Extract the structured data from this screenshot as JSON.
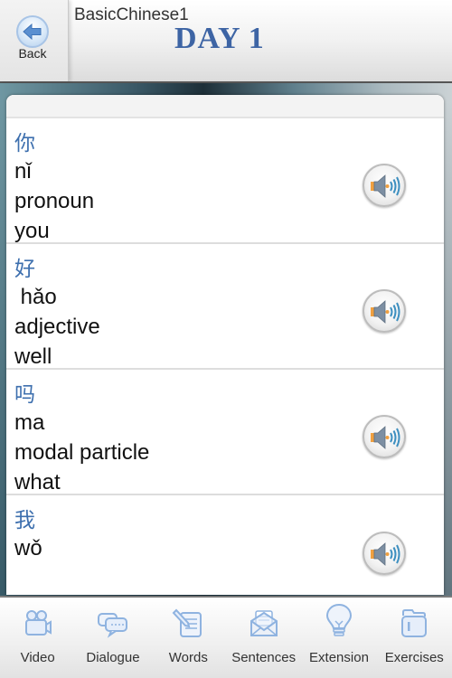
{
  "header": {
    "back_label": "Back",
    "app_title": "BasicChinese1",
    "day_title": "DAY 1"
  },
  "words": [
    {
      "hanzi": "你",
      "pinyin": "nǐ",
      "part_of_speech": "pronoun",
      "meaning": "you",
      "audio_icon": "speaker-icon"
    },
    {
      "hanzi": "好",
      "pinyin": " hǎo",
      "part_of_speech": "adjective",
      "meaning": "well",
      "audio_icon": "speaker-icon"
    },
    {
      "hanzi": "吗",
      "pinyin": "ma",
      "part_of_speech": "modal particle",
      "meaning": "what",
      "audio_icon": "speaker-icon"
    },
    {
      "hanzi": "我",
      "pinyin": "wǒ",
      "audio_icon": "speaker-icon"
    }
  ],
  "tabbar": {
    "tabs": [
      {
        "label": "Video",
        "icon": "video-camera-icon"
      },
      {
        "label": "Dialogue",
        "icon": "chat-bubbles-icon"
      },
      {
        "label": "Words",
        "icon": "notepad-pencil-icon"
      },
      {
        "label": "Sentences",
        "icon": "envelope-icon"
      },
      {
        "label": "Extension",
        "icon": "lightbulb-icon"
      },
      {
        "label": "Exercises",
        "icon": "folder-icon"
      }
    ]
  },
  "colors": {
    "accent_blue": "#3d64a4",
    "hanzi_blue": "#3d6fae",
    "icon_blue": "#8fb3e0"
  }
}
